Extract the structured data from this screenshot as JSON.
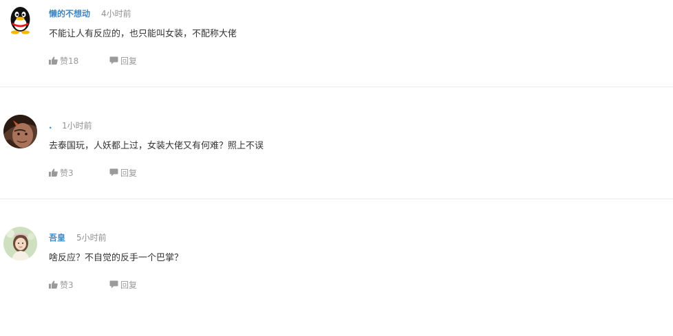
{
  "colors": {
    "username": "#3f87c5",
    "meta": "#8f8f8f",
    "text": "#333333",
    "action": "#9a9a9a",
    "divider": "#e9e9e9"
  },
  "like_icon": "thumbs-up-icon",
  "reply_icon": "speech-bubble-icon",
  "comments": [
    {
      "username": "懒的不想动",
      "time": "4小时前",
      "text": "不能让人有反应的，也只能叫女装，不配称大佬",
      "like_label": "赞18",
      "reply_label": "回复",
      "avatar_icon": "penguin-avatar"
    },
    {
      "username": ".",
      "time": "1小时前",
      "text": "去泰国玩，人妖都上过，女装大佬又有何难？照上不误",
      "like_label": "赞3",
      "reply_label": "回复",
      "avatar_icon": "warrior-avatar"
    },
    {
      "username": "吾皇",
      "time": "5小时前",
      "text": "啥反应？不自觉的反手一个巴掌？",
      "like_label": "赞3",
      "reply_label": "回复",
      "avatar_icon": "girl-avatar"
    }
  ]
}
